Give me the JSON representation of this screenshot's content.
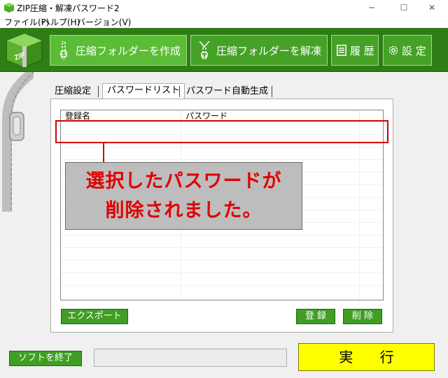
{
  "window": {
    "title": "ZIP圧縮・解凍パスワード2",
    "minimize": "─",
    "maximize": "☐",
    "close": "✕"
  },
  "menu": {
    "items": [
      "ファイル(F)",
      "ヘルプ(H)",
      "バージョン(V)"
    ]
  },
  "toolbar": {
    "logo_text": "ZIP",
    "create_label": "圧縮フォルダーを作成",
    "extract_label": "圧縮フォルダーを解凍",
    "history_label": "履 歴",
    "settings_label": "設 定"
  },
  "tabs": [
    "圧縮設定",
    "パスワードリスト",
    "パスワード自動生成"
  ],
  "list": {
    "columns": [
      "登録名",
      "パスワード"
    ]
  },
  "callout": {
    "line1": "選択したパスワードが",
    "line2": "削除されました。"
  },
  "buttons": {
    "export": "エクスポート",
    "register": "登 録",
    "delete": "削 除",
    "quit": "ソフトを終了",
    "execute": "実 行"
  },
  "colors": {
    "toolbar_bg": "#2f7d17",
    "button_green": "#46a227",
    "highlight_red": "#d10000",
    "execute_yellow": "#ffff00"
  }
}
